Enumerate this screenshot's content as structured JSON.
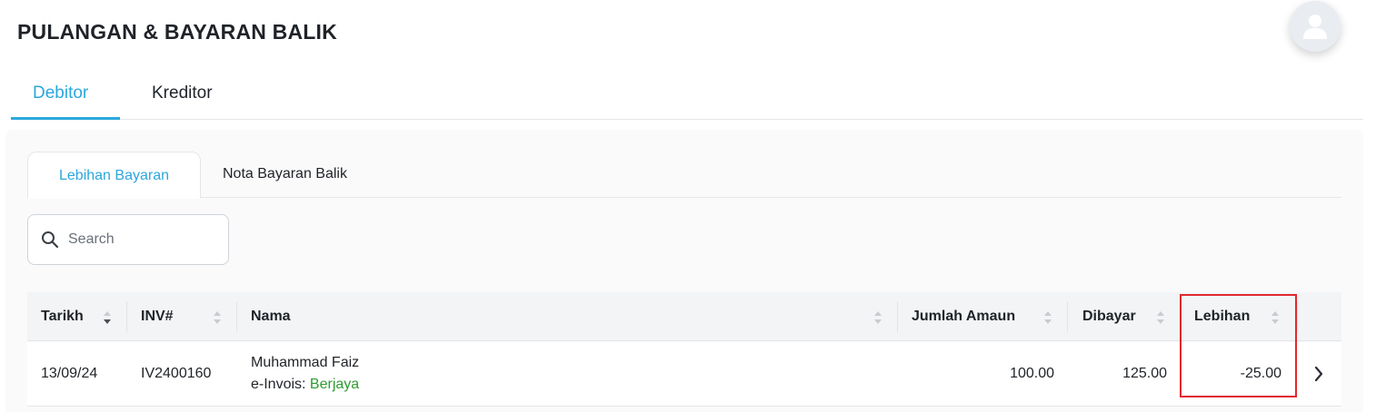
{
  "header": {
    "title": "PULANGAN & BAYARAN BALIK"
  },
  "tabs": {
    "main": [
      {
        "label": "Debitor",
        "active": true
      },
      {
        "label": "Kreditor",
        "active": false
      }
    ],
    "sub": [
      {
        "label": "Lebihan Bayaran",
        "active": true
      },
      {
        "label": "Nota Bayaran Balik",
        "active": false
      }
    ]
  },
  "search": {
    "placeholder": "Search",
    "value": ""
  },
  "table": {
    "columns": [
      "Tarikh",
      "INV#",
      "Nama",
      "Jumlah Amaun",
      "Dibayar",
      "Lebihan"
    ],
    "sorted_column": "Tarikh",
    "sort_direction": "descending",
    "rows": [
      {
        "tarikh": "13/09/24",
        "inv": "IV2400160",
        "nama": "Muhammad Faiz",
        "einvois_label": "e-Invois:",
        "einvois_status": "Berjaya",
        "jumlah_amaun": "100.00",
        "dibayar": "125.00",
        "lebihan": "-25.00"
      }
    ]
  },
  "colors": {
    "accent": "#2ba7dd",
    "success": "#2e9b31",
    "highlight": "#e0282e"
  },
  "icons": {
    "avatar": "user-icon",
    "search": "search-icon",
    "row_action": "chevron-right-icon",
    "sort": "sort-icon"
  }
}
